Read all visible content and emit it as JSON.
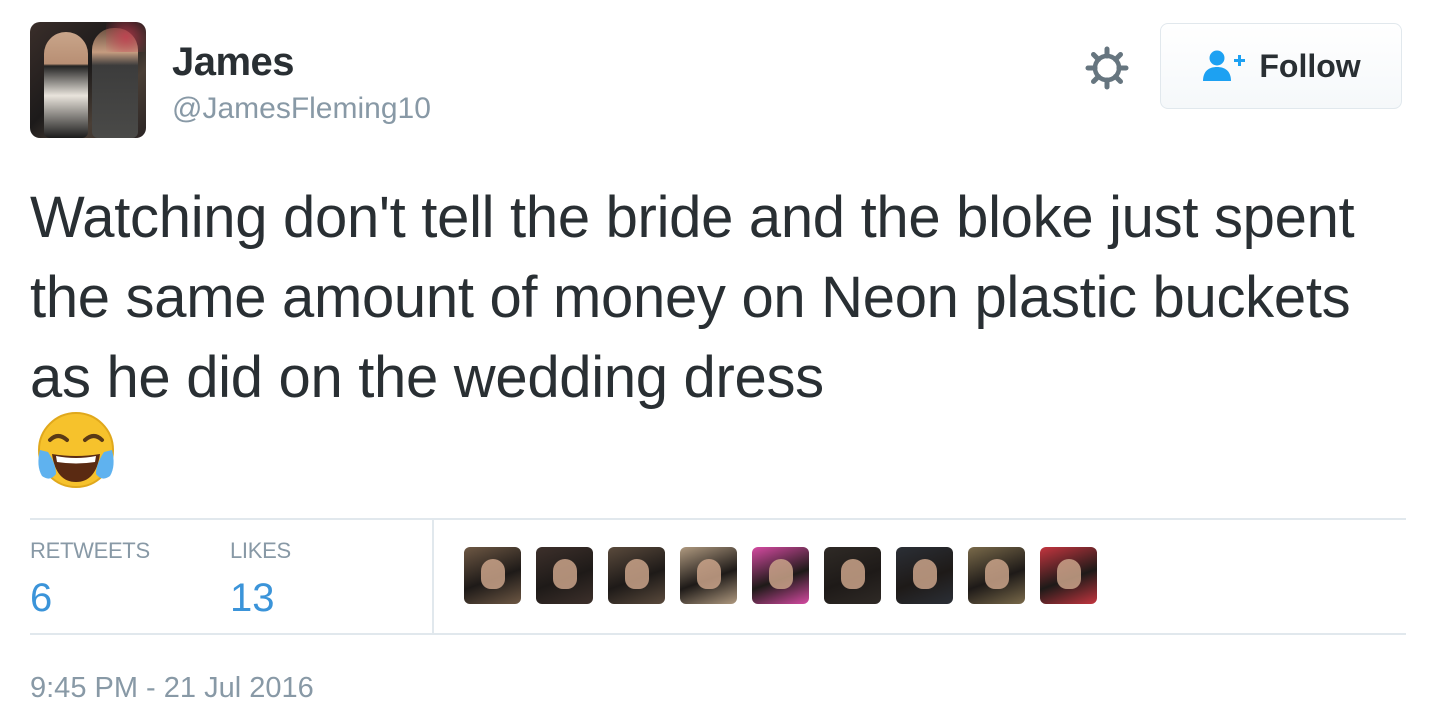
{
  "user": {
    "display_name": "James",
    "handle": "@JamesFleming10"
  },
  "actions": {
    "settings_icon": "gear-icon",
    "follow_icon": "follow-person-plus-icon",
    "follow_label": "Follow"
  },
  "tweet": {
    "text": "Watching don't tell the bride and the bloke just spent the same amount of money on Neon plastic buckets as he did on the wedding dress",
    "emoji": "face-with-tears-of-joy"
  },
  "stats": {
    "retweets_label": "RETWEETS",
    "retweets_count": "6",
    "likes_label": "LIKES",
    "likes_count": "13"
  },
  "likers": [
    {
      "color": "#6e5844"
    },
    {
      "color": "#3d302b"
    },
    {
      "color": "#5a4a3c"
    },
    {
      "color": "#b09a80"
    },
    {
      "color": "#d64aa2"
    },
    {
      "color": "#2f2a26"
    },
    {
      "color": "#2b2f36"
    },
    {
      "color": "#7a6a4a"
    },
    {
      "color": "#c4353f"
    }
  ],
  "timestamp": "9:45 PM - 21 Jul 2016",
  "colors": {
    "link_blue": "#3b94d9",
    "muted_gray": "#8899a6",
    "text_dark": "#292f33",
    "border": "#e1e8ed"
  }
}
